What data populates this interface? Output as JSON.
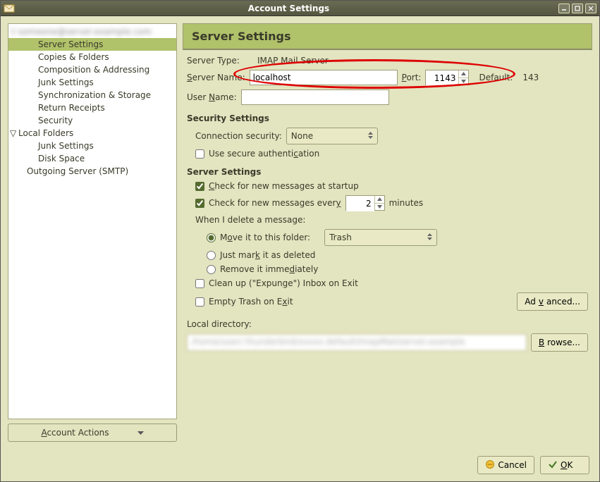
{
  "titlebar": {
    "title": "Account Settings"
  },
  "sidebar": {
    "account_blur": "someone@server.example.com",
    "items": [
      "Server Settings",
      "Copies & Folders",
      "Composition & Addressing",
      "Junk Settings",
      "Synchronization & Storage",
      "Return Receipts",
      "Security"
    ],
    "local_folders": "Local Folders",
    "local_items": [
      "Junk Settings",
      "Disk Space"
    ],
    "outgoing": "Outgoing Server (SMTP)",
    "account_actions": "Account Actions"
  },
  "header": {
    "title": "Server Settings"
  },
  "server_type": {
    "label": "Server Type:",
    "value": "IMAP Mail Server"
  },
  "server_name": {
    "label": "Server Name:",
    "value": "localhost"
  },
  "port": {
    "label": "Port:",
    "value": "1143"
  },
  "default_port": {
    "label": "Default:",
    "value": "143"
  },
  "username": {
    "label": "User Name:",
    "value": " "
  },
  "security": {
    "title": "Security Settings",
    "conn_label": "Connection security:",
    "conn_value": "None",
    "secure_auth": "Use secure authentication"
  },
  "server_settings": {
    "title": "Server Settings",
    "check_startup": "Check for new messages at startup",
    "check_every_pre": "Check for new messages every",
    "check_every_val": "2",
    "check_every_post": "minutes",
    "delete_label": "When I delete a message:",
    "move_folder": "Move it to this folder:",
    "move_folder_value": "Trash",
    "mark_deleted": "Just mark it as deleted",
    "remove_imm": "Remove it immediately",
    "cleanup": "Clean up (\"Expunge\") Inbox on Exit",
    "empty_trash": "Empty Trash on Exit",
    "advanced": "Advanced..."
  },
  "local_dir": {
    "label": "Local directory:",
    "path_blur": "/home/user/.thunderbird/xxxxx.default/ImapMail/server.example",
    "browse": "Browse..."
  },
  "footer": {
    "cancel": "Cancel",
    "ok": "OK"
  }
}
